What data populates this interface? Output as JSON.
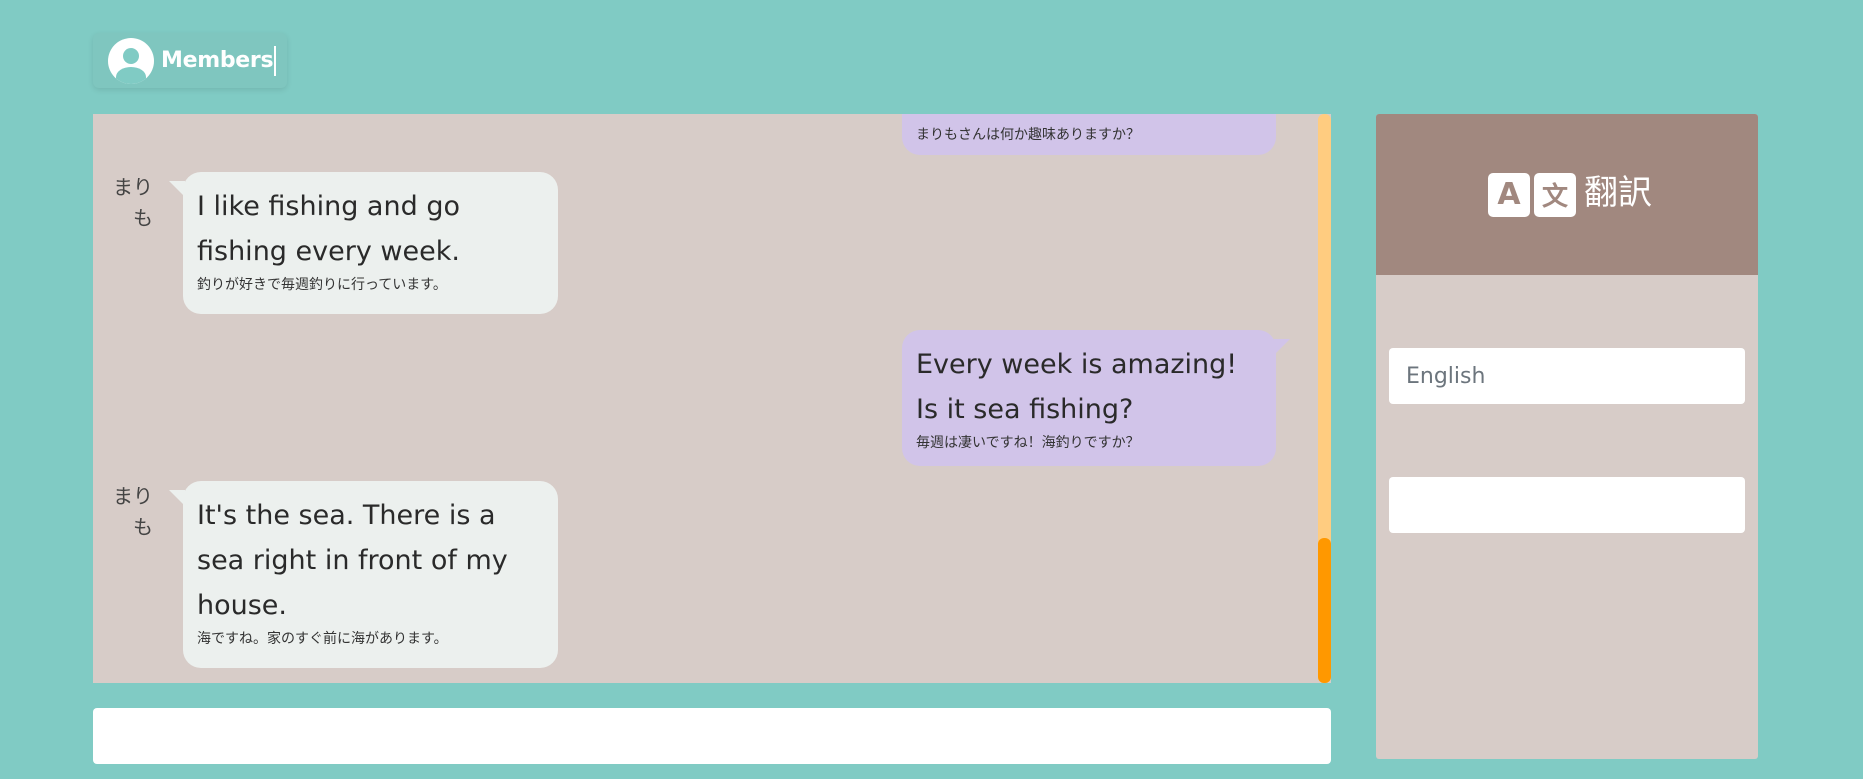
{
  "header": {
    "members_label": "Members",
    "avatar_icon": "user-avatar-icon"
  },
  "chat": {
    "messages": [
      {
        "side": "right",
        "text": "",
        "translation": "まりもさんは何か趣味ありますか？"
      },
      {
        "side": "left",
        "sender": "まりも",
        "text": "I like fishing and go fishing every week.",
        "translation": "釣りが好きで毎週釣りに行っています。"
      },
      {
        "side": "right",
        "text": "Every week is amazing! Is it sea fishing?",
        "translation": "毎週は凄いですね！海釣りですか？"
      },
      {
        "side": "left",
        "sender": "まりも",
        "text": "It's the sea. There is a sea right in front of my house.",
        "translation": "海ですね。家のすぐ前に海があります。"
      }
    ],
    "message_input_value": ""
  },
  "translate": {
    "title": "翻訳",
    "icon_letter_a": "A",
    "icon_letter_bun": "文",
    "language_input_value": "",
    "language_input_placeholder": "English",
    "second_input_value": ""
  },
  "colors": {
    "background": "#80cbc4",
    "chat_panel": "#d7ccc8",
    "bubble_left": "#ecf0ee",
    "bubble_right": "#d1c4e9",
    "translate_header": "#a1887f",
    "scroll_track": "#ffcc80",
    "scroll_thumb": "#ff9800"
  }
}
